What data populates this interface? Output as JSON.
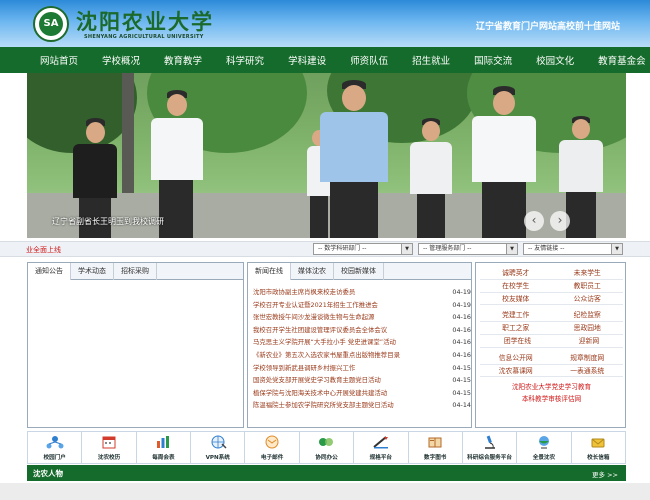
{
  "header": {
    "logo_text": "SA",
    "school_name_cn": "沈阳农业大学",
    "school_name_en": "SHENYANG AGRICULTURAL UNIVERSITY",
    "slogan": "辽宁省教育门户网站高校前十佳网站"
  },
  "nav": [
    "网站首页",
    "学校概况",
    "教育教学",
    "科学研究",
    "学科建设",
    "师资队伍",
    "招生就业",
    "国际交流",
    "校园文化",
    "教育基金会"
  ],
  "banner": {
    "caption": "辽宁省副省长王明玉到我校调研",
    "prev": "‹",
    "next": "›"
  },
  "ticker": "业全面上线",
  "selects": {
    "research": "-- 数学科研部门 --",
    "service": "-- 管理服务部门 --",
    "friend_links": "-- 友情链接 --"
  },
  "left_panel": {
    "tabs": [
      "通知公告",
      "学术动态",
      "招标采购"
    ]
  },
  "news_panel": {
    "tabs": [
      "新闻在线",
      "媒体沈农",
      "校园新媒体"
    ],
    "items": [
      {
        "title": "沈阳市政协副主席肖枫来校走访委员",
        "date": "04-19"
      },
      {
        "title": "学校召开专业认证暨2021年招生工作推进会",
        "date": "04-19"
      },
      {
        "title": "张世宏教授午间沙龙漫谈微生物与生命起源",
        "date": "04-16"
      },
      {
        "title": "我校召开学生社团建设管理评议委员会全体会议",
        "date": "04-16"
      },
      {
        "title": "马克思主义学院开展“大手拉小手 党史进课堂”活动",
        "date": "04-16"
      },
      {
        "title": "《新农业》第五次入选农家书屋重点出版物推荐目录",
        "date": "04-16"
      },
      {
        "title": "学校领导到新武县调研乡村振兴工作",
        "date": "04-15"
      },
      {
        "title": "国资处党支部开展党史学习教育主题党日活动",
        "date": "04-15"
      },
      {
        "title": "植保学院与沈阳海关技术中心开展党建共建活动",
        "date": "04-15"
      },
      {
        "title": "陈温福院士参加农学院研究所党支部主题党日活动",
        "date": "04-14"
      }
    ]
  },
  "links_panel": {
    "rows": [
      [
        "诚聘英才",
        "未来学生"
      ],
      [
        "在校学生",
        "教职员工"
      ],
      [
        "校友媒体",
        "公众访客"
      ],
      [
        "党建工作",
        "纪检监察"
      ],
      [
        "职工之家",
        "思政园地"
      ],
      [
        "团学在线",
        "迎新网"
      ],
      [
        "信息公开网",
        "规章制度网"
      ],
      [
        "沈农慕课网",
        "一表通系统"
      ]
    ],
    "red_links": [
      "沈阳农业大学党史学习教育",
      "本科教学审核评估网"
    ]
  },
  "quick_links": [
    "校园门户",
    "沈农校历",
    "每周会表",
    "VPN系统",
    "电子邮件",
    "协同办公",
    "规格平台",
    "数字图书",
    "科研综合服务平台",
    "全景沈农",
    "校长信箱"
  ],
  "people": {
    "title": "沈农人物",
    "more": "更多 >>"
  },
  "colors": {
    "brand_green": "#156b2b",
    "header_blue": "#2d8ad8",
    "link_brown": "#9a3a1a",
    "alert_red": "#d01818"
  }
}
